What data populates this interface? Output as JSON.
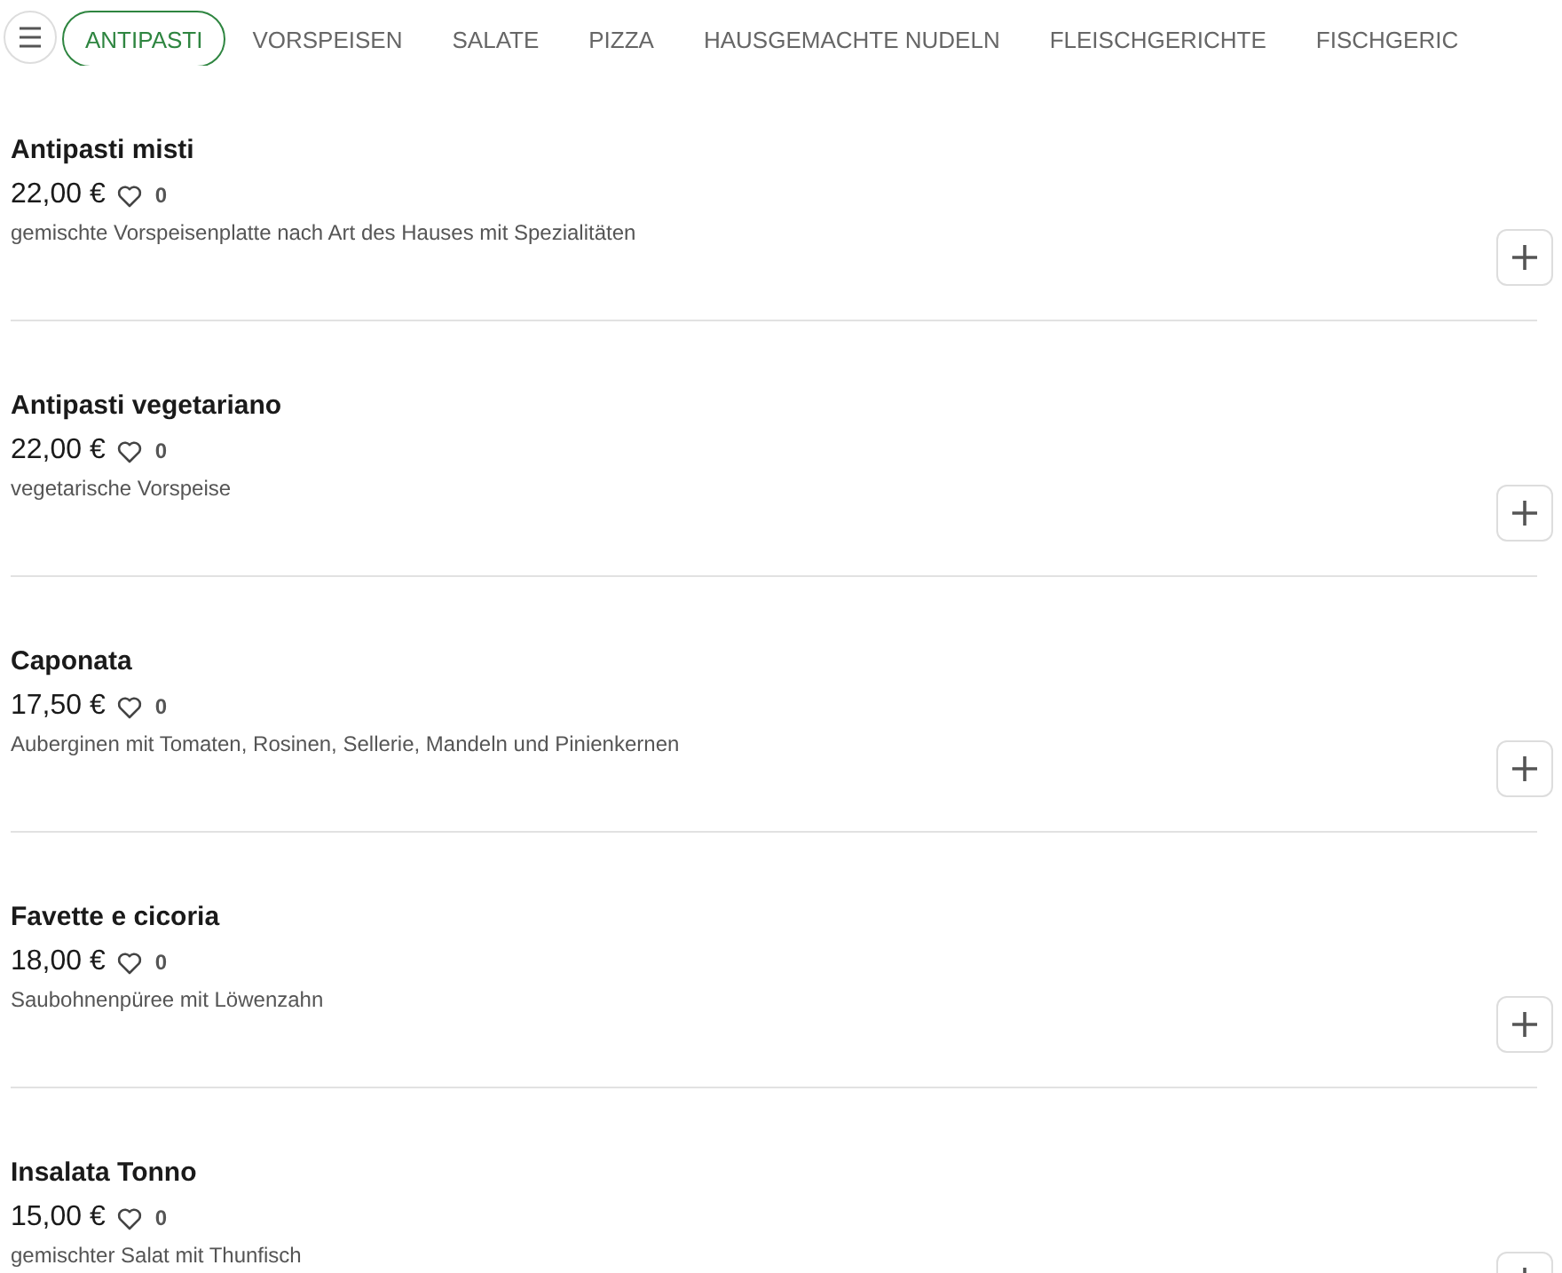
{
  "tabs": [
    {
      "label": "ANTIPASTI",
      "selected": true
    },
    {
      "label": "VORSPEISEN",
      "selected": false
    },
    {
      "label": "SALATE",
      "selected": false
    },
    {
      "label": "PIZZA",
      "selected": false
    },
    {
      "label": "HAUSGEMACHTE NUDELN",
      "selected": false
    },
    {
      "label": "FLEISCHGERICHTE",
      "selected": false
    },
    {
      "label": "FISCHGERIC",
      "selected": false
    }
  ],
  "items": [
    {
      "name": "Antipasti misti",
      "price": "22,00 €",
      "likes": "0",
      "description": "gemischte Vorspeisenplatte nach Art des Hauses mit Spezialitäten"
    },
    {
      "name": "Antipasti vegetariano",
      "price": "22,00 €",
      "likes": "0",
      "description": "vegetarische Vorspeise"
    },
    {
      "name": "Caponata",
      "price": "17,50 €",
      "likes": "0",
      "description": "Auberginen mit Tomaten, Rosinen, Sellerie, Mandeln und Pinienkernen"
    },
    {
      "name": "Favette e cicoria",
      "price": "18,00 €",
      "likes": "0",
      "description": "Saubohnenpüree mit Löwenzahn"
    },
    {
      "name": "Insalata Tonno",
      "price": "15,00 €",
      "likes": "0",
      "description": "gemischter Salat mit Thunfisch"
    }
  ]
}
